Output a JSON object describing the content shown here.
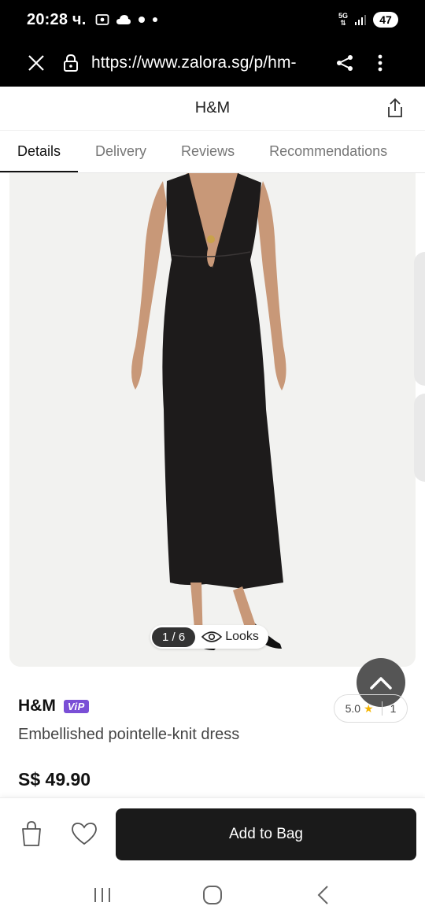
{
  "status_bar": {
    "time": "20:28 ч.",
    "network": "5G",
    "battery": "47"
  },
  "browser": {
    "url": "https://www.zalora.sg/p/hm-",
    "icons": [
      "close-icon",
      "lock-icon",
      "share-icon",
      "more-vert-icon"
    ]
  },
  "header": {
    "brand": "H&M"
  },
  "tabs": [
    {
      "label": "Details",
      "active": true
    },
    {
      "label": "Delivery",
      "active": false
    },
    {
      "label": "Reviews",
      "active": false
    },
    {
      "label": "Recommendations",
      "active": false
    }
  ],
  "gallery": {
    "counter": "1 / 6",
    "looks_label": "Looks"
  },
  "product": {
    "brand": "H&M",
    "vip_label": "ViP",
    "rating": "5.0",
    "review_count": "1",
    "name": "Embellished pointelle-knit dress",
    "price": "S$ 49.90"
  },
  "actions": {
    "add_to_bag": "Add to Bag"
  },
  "colors": {
    "vip": "#7a4fd6",
    "star": "#f5b400",
    "button": "#1a1a1a"
  }
}
